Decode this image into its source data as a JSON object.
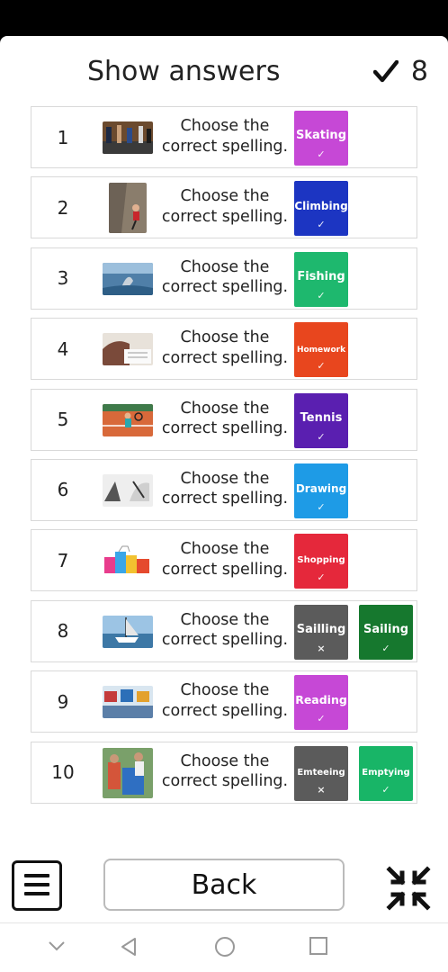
{
  "header": {
    "title": "Show answers",
    "score": "8",
    "score_icon": "check-icon"
  },
  "prompt_line1": "Choose the",
  "prompt_line2": "correct spelling.",
  "rows": [
    {
      "num": "1",
      "image": "skating-photo",
      "answers": [
        {
          "word": "Skating",
          "mark": "✓",
          "color": "#c648d6"
        }
      ]
    },
    {
      "num": "2",
      "image": "climbing-photo",
      "answers": [
        {
          "word": "Climbing",
          "mark": "✓",
          "color": "#1c35c2"
        }
      ]
    },
    {
      "num": "3",
      "image": "fishing-photo",
      "answers": [
        {
          "word": "Fishing",
          "mark": "✓",
          "color": "#1eb86e"
        }
      ]
    },
    {
      "num": "4",
      "image": "homework-photo",
      "answers": [
        {
          "word": "Homework",
          "mark": "✓",
          "color": "#e8461e"
        }
      ]
    },
    {
      "num": "5",
      "image": "tennis-photo",
      "answers": [
        {
          "word": "Tennis",
          "mark": "✓",
          "color": "#5a1fb0"
        }
      ]
    },
    {
      "num": "6",
      "image": "drawing-photo",
      "answers": [
        {
          "word": "Drawing",
          "mark": "✓",
          "color": "#1e9be6"
        }
      ]
    },
    {
      "num": "7",
      "image": "shopping-photo",
      "answers": [
        {
          "word": "Shopping",
          "mark": "✓",
          "color": "#e5283b"
        }
      ]
    },
    {
      "num": "8",
      "image": "sailing-photo",
      "answers": [
        {
          "word": "Sailling",
          "mark": "×",
          "color": "#5b5b5b"
        },
        {
          "word": "Sailing",
          "mark": "✓",
          "color": "#16782e"
        }
      ]
    },
    {
      "num": "9",
      "image": "reading-photo",
      "answers": [
        {
          "word": "Reading",
          "mark": "✓",
          "color": "#c648d6"
        }
      ]
    },
    {
      "num": "10",
      "image": "emptying-photo",
      "answers": [
        {
          "word": "Emteeing",
          "mark": "×",
          "color": "#5b5b5b"
        },
        {
          "word": "Emptying",
          "mark": "✓",
          "color": "#18b567"
        }
      ]
    }
  ],
  "footer": {
    "back_label": "Back",
    "menu_icon": "hamburger-menu-icon",
    "shrink_icon": "exit-fullscreen-icon"
  },
  "navbar": {
    "icons": [
      "chevron-down-icon",
      "back-triangle-icon",
      "home-circle-icon",
      "recents-square-icon"
    ]
  }
}
